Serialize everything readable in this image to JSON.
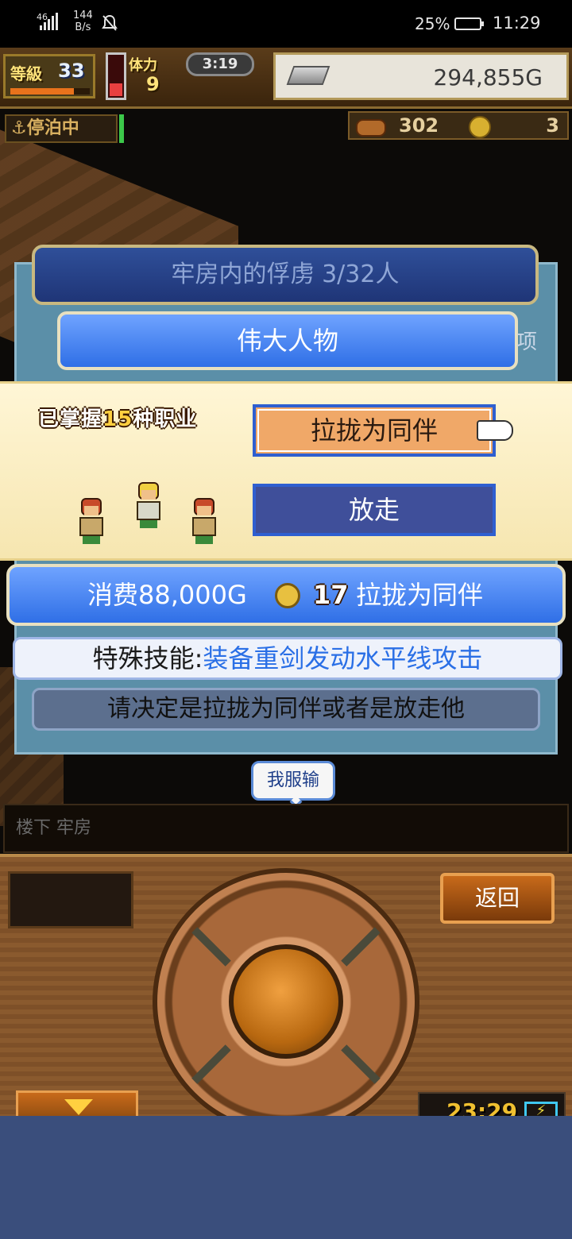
{
  "status_bar": {
    "network": "46",
    "net_speed_value": "144",
    "net_speed_unit": "B/s",
    "battery_percent": "25%",
    "time": "11:29"
  },
  "hud": {
    "level_label": "等級",
    "level_value": "33",
    "stamina_label": "体力",
    "stamina_value": "9",
    "stamina_timer": "3:19",
    "gold": "294,855G",
    "docked_status": "停泊中",
    "food_count": "302",
    "coin_count": "3"
  },
  "dialog": {
    "title": "牢房内的俘虏  3/32人",
    "category_tab": "伟大人物",
    "tab_peek": "项",
    "mastered_prefix": "已掌握",
    "mastered_count": "15",
    "mastered_suffix": "种职业",
    "recruit_button": "拉拢为同伴",
    "release_button": "放走",
    "cost_text": "消费88,000G",
    "cost_coin_count": "17",
    "cost_action": "拉拢为同伴",
    "skill_label": "特殊技能:",
    "skill_value": "装备重剑发动水平线攻击",
    "prompt": "请决定是拉拢为同伴或者是放走他"
  },
  "speech_bubble": "我服输",
  "location": "楼下 牢房",
  "controls": {
    "back_button": "返回",
    "game_clock": "23:29"
  },
  "colors": {
    "recruit_button_bg": "#f0a868",
    "release_button_bg": "#3f4f9a",
    "banner_blue": "#2f6fe6",
    "skill_highlight": "#2a6fe6"
  }
}
